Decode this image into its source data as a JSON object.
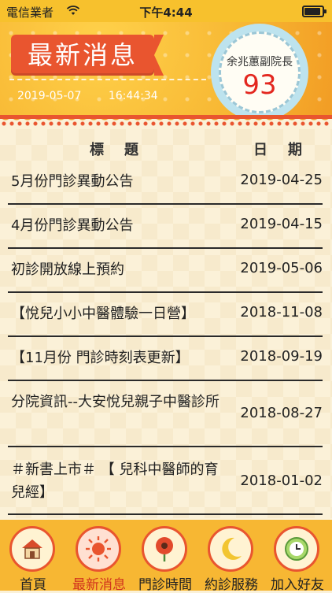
{
  "status_bar": {
    "carrier": "電信業者",
    "time": "下午4:44"
  },
  "header": {
    "title": "最新消息",
    "date": "2019-05-07",
    "time": "16:44:34",
    "doctor_name": "余兆蕙副院長",
    "doctor_count": "93"
  },
  "table": {
    "col_title": "標題",
    "col_date": "日期",
    "rows": [
      {
        "title": "5月份門診異動公告",
        "date": "2019-04-25"
      },
      {
        "title": "4月份門診異動公告",
        "date": "2019-04-15"
      },
      {
        "title": "初診開放線上預約",
        "date": "2019-05-06"
      },
      {
        "title": "【悅兒小小中醫體驗一日營】",
        "date": "2018-11-08"
      },
      {
        "title": "【11月份 門診時刻表更新】",
        "date": "2018-09-19"
      },
      {
        "title": "分院資訊--大安悅兒親子中醫診所",
        "date": "2018-08-27"
      },
      {
        "title": "＃新書上市＃ 【 兒科中醫師的育兒經】",
        "date": "2018-01-02"
      }
    ]
  },
  "tabs": [
    {
      "label": "首頁",
      "icon": "house-icon"
    },
    {
      "label": "最新消息",
      "icon": "sun-icon"
    },
    {
      "label": "門診時間",
      "icon": "flower-icon"
    },
    {
      "label": "約診服務",
      "icon": "moon-icon"
    },
    {
      "label": "加入好友",
      "icon": "clock-icon"
    }
  ],
  "colors": {
    "accent": "#e9552f",
    "header_bg": "#f7b733",
    "count": "#e3271f"
  }
}
